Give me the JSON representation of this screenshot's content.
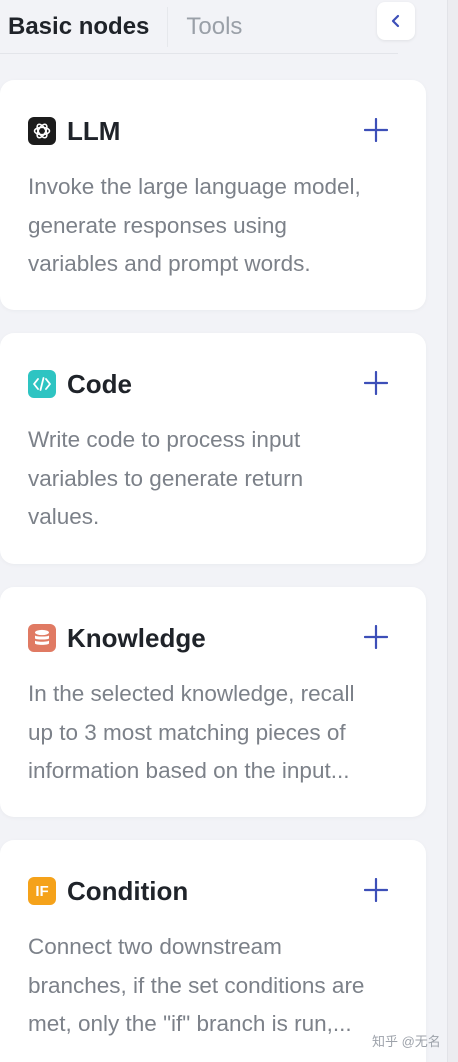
{
  "tabs": {
    "basic_nodes": "Basic nodes",
    "tools": "Tools"
  },
  "collapse_icon": "chevron-left-icon",
  "accent_color": "#3d4fb8",
  "nodes": [
    {
      "title": "LLM",
      "icon": "openai-icon",
      "icon_color": "#1c1c1c",
      "desc_lines": [
        "Invoke the large language model,",
        "generate responses using",
        "variables and prompt words."
      ]
    },
    {
      "title": "Code",
      "icon": "code-icon",
      "icon_color": "#2ec4c2",
      "desc_lines": [
        "Write code to process input",
        "variables to generate return",
        "values."
      ]
    },
    {
      "title": "Knowledge",
      "icon": "database-icon",
      "icon_color": "#e07a63",
      "desc_lines": [
        "In the selected knowledge, recall",
        "up to 3 most matching pieces of",
        "information based on the input..."
      ]
    },
    {
      "title": "Condition",
      "icon": "if-icon",
      "icon_label": "IF",
      "icon_color": "#f5a21a",
      "desc_lines": [
        "Connect two downstream",
        "branches, if the set conditions are",
        "met, only the \"if\" branch is run,..."
      ]
    }
  ],
  "watermark": "知乎 @无名"
}
